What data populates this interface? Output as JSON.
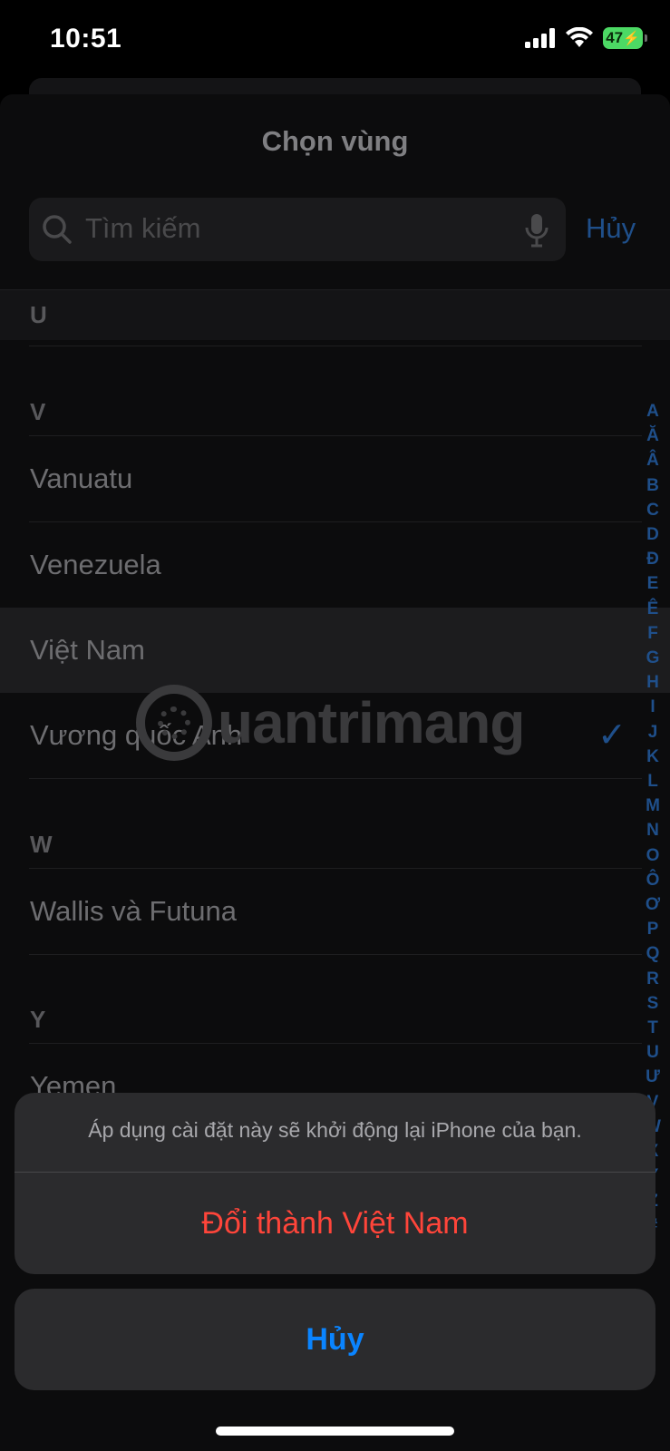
{
  "status_bar": {
    "time": "10:51",
    "battery": "47"
  },
  "sheet": {
    "title": "Chọn vùng",
    "search_placeholder": "Tìm kiếm",
    "cancel_label": "Hủy"
  },
  "list": {
    "sections": [
      {
        "header": "U",
        "rows": []
      },
      {
        "header": "V",
        "rows": [
          "Vanuatu",
          "Venezuela",
          "Việt Nam",
          "Vương quốc Anh"
        ]
      },
      {
        "header": "W",
        "rows": [
          "Wallis và Futuna"
        ]
      },
      {
        "header": "Y",
        "rows": [
          "Yemen"
        ]
      }
    ],
    "selected_row": "Việt Nam",
    "checked_row": "Vương quốc Anh"
  },
  "index_letters": [
    "A",
    "Ă",
    "Â",
    "B",
    "C",
    "D",
    "Đ",
    "E",
    "Ê",
    "F",
    "G",
    "H",
    "I",
    "J",
    "K",
    "L",
    "M",
    "N",
    "O",
    "Ô",
    "Ơ",
    "P",
    "Q",
    "R",
    "S",
    "T",
    "U",
    "Ư",
    "V",
    "W",
    "X",
    "Y",
    "Z",
    "#"
  ],
  "watermark": "uantrimang",
  "action_sheet": {
    "message": "Áp dụng cài đặt này sẽ khởi động lại iPhone của bạn.",
    "confirm_label": "Đổi thành Việt Nam",
    "cancel_label": "Hủy"
  },
  "colors": {
    "accent": "#0a84ff",
    "destructive": "#ff453a"
  }
}
